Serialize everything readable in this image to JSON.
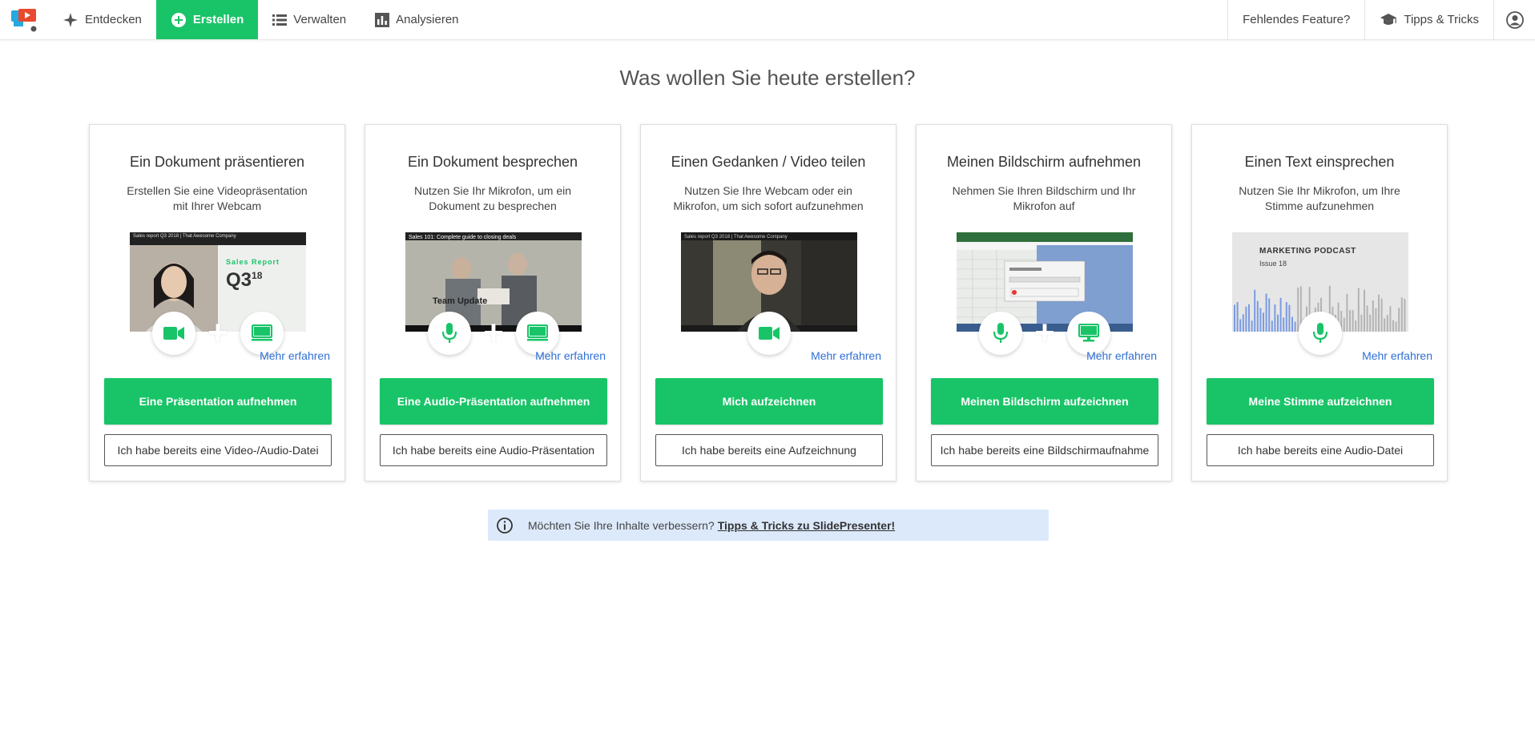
{
  "nav": {
    "items": [
      {
        "label": "Entdecken"
      },
      {
        "label": "Erstellen"
      },
      {
        "label": "Verwalten"
      },
      {
        "label": "Analysieren"
      }
    ],
    "right": {
      "feature_label": "Fehlendes Feature?",
      "tips_label": "Tipps & Tricks"
    }
  },
  "page": {
    "title": "Was wollen Sie heute erstellen?"
  },
  "cards": [
    {
      "title": "Ein Dokument präsentieren",
      "desc": "Erstellen Sie eine Videopräsentation mit Ihrer Webcam",
      "thumb": {
        "caption": "Sales report Q3 2018 | That Awesome Company",
        "label1": "Sales Report",
        "label2": "Q3",
        "label3": "18"
      },
      "icons": [
        "camera-icon",
        "monitor-icon"
      ],
      "more": "Mehr erfahren",
      "primary": "Eine Präsentation aufnehmen",
      "secondary": "Ich habe bereits eine Video-/Audio-Datei"
    },
    {
      "title": "Ein Dokument besprechen",
      "desc": "Nutzen Sie Ihr Mikrofon, um ein Dokument zu besprechen",
      "thumb": {
        "caption": "Sales 101: Complete guide to closing deals",
        "label1": "Team Update"
      },
      "icons": [
        "microphone-icon",
        "monitor-icon"
      ],
      "more": "Mehr erfahren",
      "primary": "Eine Audio-Präsentation aufnehmen",
      "secondary": "Ich habe bereits eine Audio-Präsentation"
    },
    {
      "title": "Einen Gedanken / Video teilen",
      "desc": "Nutzen Sie Ihre Webcam oder ein Mikrofon, um sich sofort aufzunehmen",
      "thumb": {
        "caption": "Sales report Q3 2018 | That Awesome Company"
      },
      "icons": [
        "camera-icon"
      ],
      "more": "Mehr erfahren",
      "primary": "Mich aufzeichnen",
      "secondary": "Ich habe bereits eine Aufzeichnung"
    },
    {
      "title": "Meinen Bildschirm aufnehmen",
      "desc": "Nehmen Sie Ihren Bildschirm und Ihr Mikrofon auf",
      "thumb": {
        "caption": ""
      },
      "icons": [
        "microphone-icon",
        "monitor-icon"
      ],
      "more": "Mehr erfahren",
      "primary": "Meinen Bildschirm aufzeichnen",
      "secondary": "Ich habe bereits eine Bildschirmaufnahme"
    },
    {
      "title": "Einen Text einsprechen",
      "desc": "Nutzen Sie Ihr Mikrofon, um Ihre Stimme aufzunehmen",
      "thumb": {
        "label1": "MARKETING PODCAST",
        "label2": "Issue 18"
      },
      "icons": [
        "microphone-icon"
      ],
      "more": "Mehr erfahren",
      "primary": "Meine Stimme aufzeichnen",
      "secondary": "Ich habe bereits eine Audio-Datei"
    }
  ],
  "info": {
    "text": "Möchten Sie Ihre Inhalte verbessern?",
    "link": "Tipps & Tricks zu SlidePresenter!"
  },
  "colors": {
    "accent": "#19c468",
    "link": "#2f6fd6",
    "info_bg": "#dce9fb"
  }
}
